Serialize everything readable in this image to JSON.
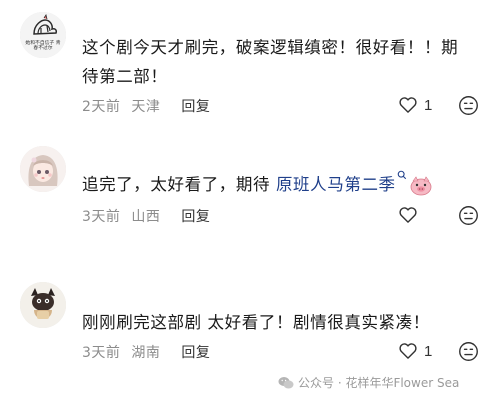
{
  "comments": [
    {
      "avatar_caption": "她和不自信子 青春不过尔",
      "text_line1": "这个剧今天才刷完，破案逻辑缜密！很好看！！期",
      "text_line2": "待第二部！",
      "time": "2天前",
      "location": "天津",
      "reply": "回复",
      "likes": "1"
    },
    {
      "text_before": "追完了，太好看了，期待 ",
      "link": "原班人马第二季",
      "time": "3天前",
      "location": "山西",
      "reply": "回复"
    },
    {
      "text": "刚刚刷完这部剧 太好看了！剧情很真实紧凑！",
      "time": "3天前",
      "location": "湖南",
      "reply": "回复",
      "likes": "1"
    }
  ],
  "watermark": "公众号 · 花样年华Flower Sea",
  "icons": [
    "heart-outline-icon",
    "frown-face-icon",
    "search-icon",
    "pig-emoji",
    "wechat-icon"
  ],
  "colors": {
    "link": "#1f3f8a",
    "meta": "#8c8c8c",
    "text": "#1a1a1a"
  }
}
